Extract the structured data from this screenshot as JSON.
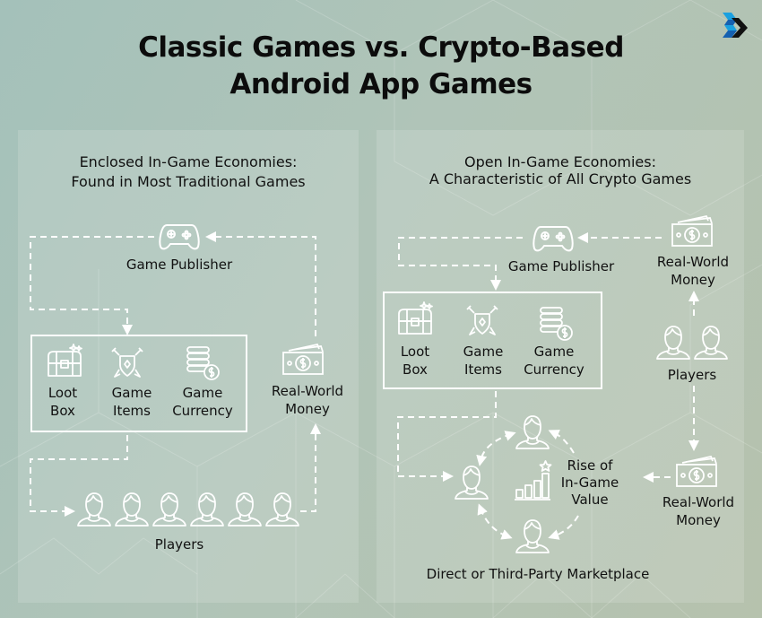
{
  "title": {
    "line1": "Classic Games vs. Crypto-Based",
    "line2": "Android App Games"
  },
  "logo": {
    "icon": "brand-chevron-logo",
    "colors": [
      "#1aa0e0",
      "#1560b0",
      "#111111"
    ]
  },
  "colors": {
    "background": "#a9c2b8",
    "panel": "rgba(255,255,255,0.14)",
    "lines": "#ffffff",
    "text": "#111111"
  },
  "left_panel": {
    "subtitle_line1": "Enclosed In-Game Economies:",
    "subtitle_line2": "Found in Most Traditional Games",
    "publisher": {
      "icon": "gamepad-icon",
      "label": "Game Publisher"
    },
    "items": [
      {
        "icon": "treasure-chest-icon",
        "line1": "Loot",
        "line2": "Box"
      },
      {
        "icon": "shield-swords-icon",
        "line1": "Game",
        "line2": "Items"
      },
      {
        "icon": "coin-stack-icon",
        "line1": "Game",
        "line2": "Currency"
      }
    ],
    "money": {
      "icon": "cash-icon",
      "line1": "Real-World",
      "line2": "Money"
    },
    "players": {
      "icon": "user-icon",
      "count": 6,
      "label": "Players"
    }
  },
  "right_panel": {
    "subtitle_line1": "Open In-Game Economies:",
    "subtitle_line2": "A Characteristic of All Crypto Games",
    "publisher": {
      "icon": "gamepad-icon",
      "label": "Game Publisher"
    },
    "money_top": {
      "icon": "cash-icon",
      "line1": "Real-World",
      "line2": "Money"
    },
    "items": [
      {
        "icon": "treasure-chest-icon",
        "line1": "Loot",
        "line2": "Box"
      },
      {
        "icon": "shield-swords-icon",
        "line1": "Game",
        "line2": "Items"
      },
      {
        "icon": "coin-stack-icon",
        "line1": "Game",
        "line2": "Currency"
      }
    ],
    "players": {
      "icon": "user-icon",
      "count": 2,
      "label": "Players"
    },
    "money_bottom": {
      "icon": "cash-icon",
      "line1": "Real-World",
      "line2": "Money"
    },
    "rise": {
      "icon": "bar-chart-star-icon",
      "line1": "Rise of",
      "line2": "In-Game",
      "line3": "Value"
    },
    "marketplace": {
      "icon": "user-icon",
      "count": 3,
      "label": "Direct or Third-Party Marketplace"
    }
  }
}
